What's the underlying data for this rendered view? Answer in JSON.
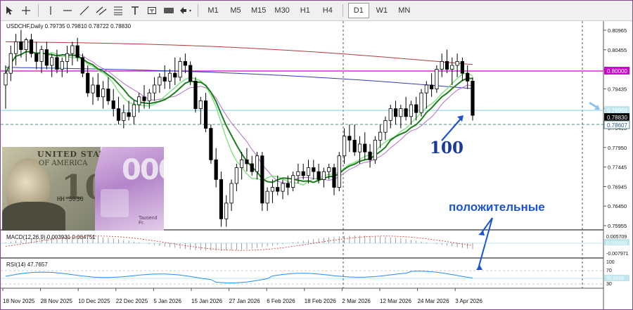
{
  "toolbar": {
    "tools": [
      "cursor-icon",
      "crosshair-icon",
      "vertical-line-icon",
      "horizontal-line-icon",
      "trendline-icon",
      "channel-icon",
      "fibonacci-icon",
      "text-icon",
      "label-icon",
      "shape-icon",
      "arrows-icon"
    ],
    "timeframes": [
      "M1",
      "M5",
      "M15",
      "M30",
      "H1",
      "H4",
      "D1",
      "W1",
      "MN"
    ],
    "active_timeframe": "D1"
  },
  "chart_header": "USDCHF,Daily 0.79735 0.79810 0.78722 0.78830",
  "macd_label": "MACD(12,26,9) 0.003931 0.004751",
  "rsi_label": "RSI(14) 47.7657",
  "price_axis": [
    "0.80965",
    "0.80455",
    "0.79945",
    "0.79435",
    "0.78925",
    "0.78415",
    "0.77950",
    "0.77445",
    "0.76945",
    "0.76450",
    "0.75955"
  ],
  "price_tags": {
    "level_magenta": "0.80000",
    "level_cyan": "0.78960",
    "current_price": "0.78830",
    "level_dashed": "0.78607"
  },
  "macd_axis": [
    "0.005709",
    "0.000000",
    "-0.007971"
  ],
  "rsi_axis": [
    "100",
    "70",
    "50.0000",
    "30",
    "0"
  ],
  "date_axis": [
    "18 Nov 2025",
    "28 Nov 2025",
    "10 Dec 2025",
    "22 Dec 2025",
    "5 Jan 2026",
    "15 Jan 2026",
    "27 Jan 2026",
    "6 Feb 2026",
    "18 Feb 2026",
    "2 Mar 2026",
    "12 Mar 2026",
    "24 Mar 2026",
    "3 Apr 2026"
  ],
  "annotations": {
    "label_100": "100",
    "label_positive": "положительные"
  },
  "colors": {
    "ma_red": "#b23a3a",
    "ma_blue": "#3a3ab8",
    "ma_green": "#1e7d1e",
    "ma_lightgreen": "#7fe27f",
    "ma_violet": "#b070c8",
    "level_magenta": "#d000d0",
    "level_cyan": "#7fd0e0",
    "annotation_blue": "#1a53d6",
    "rsi_line": "#1e90ff"
  },
  "chart_data": {
    "type": "candlestick",
    "title": "USDCHF,Daily",
    "price_range": [
      0.7592,
      0.811
    ],
    "candles": [
      [
        0.796,
        0.801,
        0.79,
        0.799
      ],
      [
        0.799,
        0.806,
        0.797,
        0.804
      ],
      [
        0.804,
        0.809,
        0.801,
        0.807
      ],
      [
        0.807,
        0.81,
        0.803,
        0.805
      ],
      [
        0.805,
        0.808,
        0.802,
        0.8075
      ],
      [
        0.8075,
        0.809,
        0.803,
        0.804
      ],
      [
        0.804,
        0.807,
        0.8,
        0.802
      ],
      [
        0.802,
        0.806,
        0.799,
        0.805
      ],
      [
        0.805,
        0.807,
        0.8,
        0.801
      ],
      [
        0.801,
        0.804,
        0.798,
        0.803
      ],
      [
        0.803,
        0.805,
        0.799,
        0.8
      ],
      [
        0.8,
        0.803,
        0.798,
        0.802
      ],
      [
        0.802,
        0.806,
        0.799,
        0.804
      ],
      [
        0.804,
        0.807,
        0.801,
        0.806
      ],
      [
        0.806,
        0.808,
        0.802,
        0.803
      ],
      [
        0.803,
        0.804,
        0.798,
        0.799
      ],
      [
        0.799,
        0.801,
        0.793,
        0.794
      ],
      [
        0.794,
        0.798,
        0.791,
        0.796
      ],
      [
        0.796,
        0.799,
        0.792,
        0.793
      ],
      [
        0.793,
        0.797,
        0.79,
        0.795
      ],
      [
        0.795,
        0.798,
        0.791,
        0.792
      ],
      [
        0.792,
        0.795,
        0.788,
        0.79
      ],
      [
        0.79,
        0.793,
        0.786,
        0.787
      ],
      [
        0.787,
        0.791,
        0.785,
        0.789
      ],
      [
        0.789,
        0.792,
        0.787,
        0.788
      ],
      [
        0.788,
        0.792,
        0.786,
        0.791
      ],
      [
        0.791,
        0.794,
        0.789,
        0.793
      ],
      [
        0.793,
        0.796,
        0.79,
        0.792
      ],
      [
        0.792,
        0.795,
        0.79,
        0.794
      ],
      [
        0.794,
        0.798,
        0.792,
        0.796
      ],
      [
        0.796,
        0.799,
        0.794,
        0.798
      ],
      [
        0.798,
        0.801,
        0.795,
        0.797
      ],
      [
        0.797,
        0.8,
        0.795,
        0.799
      ],
      [
        0.799,
        0.803,
        0.796,
        0.798
      ],
      [
        0.798,
        0.803,
        0.797,
        0.802
      ],
      [
        0.802,
        0.804,
        0.799,
        0.801
      ],
      [
        0.801,
        0.802,
        0.796,
        0.797
      ],
      [
        0.797,
        0.798,
        0.789,
        0.79
      ],
      [
        0.79,
        0.793,
        0.786,
        0.792
      ],
      [
        0.792,
        0.794,
        0.784,
        0.785
      ],
      [
        0.785,
        0.786,
        0.776,
        0.777
      ],
      [
        0.777,
        0.78,
        0.77,
        0.772
      ],
      [
        0.772,
        0.774,
        0.76,
        0.762
      ],
      [
        0.762,
        0.768,
        0.76,
        0.766
      ],
      [
        0.766,
        0.772,
        0.764,
        0.771
      ],
      [
        0.771,
        0.776,
        0.769,
        0.775
      ],
      [
        0.775,
        0.779,
        0.772,
        0.777
      ],
      [
        0.777,
        0.78,
        0.774,
        0.776
      ],
      [
        0.776,
        0.778,
        0.773,
        0.774
      ],
      [
        0.774,
        0.779,
        0.772,
        0.778
      ],
      [
        0.778,
        0.779,
        0.764,
        0.766
      ],
      [
        0.766,
        0.77,
        0.764,
        0.769
      ],
      [
        0.769,
        0.772,
        0.766,
        0.77
      ],
      [
        0.77,
        0.773,
        0.768,
        0.769
      ],
      [
        0.769,
        0.772,
        0.767,
        0.771
      ],
      [
        0.771,
        0.773,
        0.768,
        0.77
      ],
      [
        0.77,
        0.774,
        0.769,
        0.773
      ],
      [
        0.773,
        0.776,
        0.771,
        0.774
      ],
      [
        0.774,
        0.776,
        0.772,
        0.773
      ],
      [
        0.773,
        0.777,
        0.771,
        0.775
      ],
      [
        0.775,
        0.777,
        0.772,
        0.774
      ],
      [
        0.774,
        0.776,
        0.771,
        0.772
      ],
      [
        0.772,
        0.775,
        0.77,
        0.774
      ],
      [
        0.774,
        0.776,
        0.772,
        0.775
      ],
      [
        0.775,
        0.776,
        0.768,
        0.77
      ],
      [
        0.77,
        0.779,
        0.769,
        0.778
      ],
      [
        0.778,
        0.785,
        0.776,
        0.783
      ],
      [
        0.783,
        0.786,
        0.779,
        0.782
      ],
      [
        0.782,
        0.786,
        0.778,
        0.779
      ],
      [
        0.779,
        0.783,
        0.776,
        0.781
      ],
      [
        0.781,
        0.784,
        0.777,
        0.779
      ],
      [
        0.779,
        0.781,
        0.775,
        0.777
      ],
      [
        0.777,
        0.783,
        0.776,
        0.782
      ],
      [
        0.782,
        0.786,
        0.78,
        0.784
      ],
      [
        0.784,
        0.788,
        0.782,
        0.787
      ],
      [
        0.787,
        0.791,
        0.785,
        0.79
      ],
      [
        0.79,
        0.792,
        0.786,
        0.788
      ],
      [
        0.788,
        0.791,
        0.785,
        0.79
      ],
      [
        0.79,
        0.793,
        0.787,
        0.788
      ],
      [
        0.788,
        0.792,
        0.786,
        0.791
      ],
      [
        0.791,
        0.793,
        0.787,
        0.789
      ],
      [
        0.789,
        0.795,
        0.788,
        0.794
      ],
      [
        0.794,
        0.797,
        0.79,
        0.796
      ],
      [
        0.796,
        0.799,
        0.793,
        0.795
      ],
      [
        0.795,
        0.801,
        0.794,
        0.8
      ],
      [
        0.8,
        0.804,
        0.798,
        0.802
      ],
      [
        0.802,
        0.805,
        0.799,
        0.8
      ],
      [
        0.8,
        0.803,
        0.796,
        0.801
      ],
      [
        0.801,
        0.804,
        0.798,
        0.802
      ],
      [
        0.802,
        0.803,
        0.797,
        0.799
      ],
      [
        0.799,
        0.801,
        0.795,
        0.797
      ],
      [
        0.797,
        0.798,
        0.787,
        0.7883
      ]
    ],
    "horizontal_levels": [
      0.8,
      0.7896,
      0.78607
    ],
    "vertical_dashed_dates": [
      "2 Mar 2026",
      "3 Apr 2026"
    ]
  }
}
